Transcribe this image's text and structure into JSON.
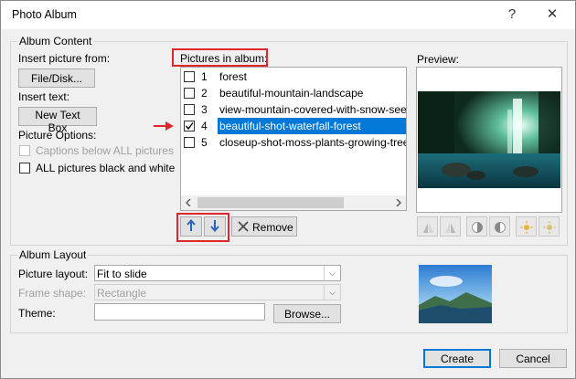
{
  "window": {
    "title": "Photo Album",
    "help": "?",
    "close": "✕"
  },
  "album_content": {
    "legend": "Album Content",
    "insert_picture_from": "Insert picture from:",
    "file_disk_button": "File/Disk...",
    "insert_text": "Insert text:",
    "new_text_box_button": "New Text Box",
    "picture_options": "Picture Options:",
    "captions_below": "Captions below ALL pictures",
    "all_black_white": "ALL pictures black and white",
    "pictures_in_album": "Pictures in album:",
    "items": [
      {
        "num": "1",
        "name": "forest",
        "checked": false,
        "selected": false
      },
      {
        "num": "2",
        "name": "beautiful-mountain-landscape",
        "checked": false,
        "selected": false
      },
      {
        "num": "3",
        "name": "view-mountain-covered-with-snow-seen",
        "checked": false,
        "selected": false
      },
      {
        "num": "4",
        "name": "beautiful-shot-waterfall-forest",
        "checked": true,
        "selected": true
      },
      {
        "num": "5",
        "name": "closeup-shot-moss-plants-growing-tree",
        "checked": false,
        "selected": false
      }
    ],
    "remove_button": "Remove",
    "preview_label": "Preview:"
  },
  "album_layout": {
    "legend": "Album Layout",
    "picture_layout_label": "Picture layout:",
    "picture_layout_value": "Fit to slide",
    "frame_shape_label": "Frame shape:",
    "frame_shape_value": "Rectangle",
    "theme_label": "Theme:",
    "theme_value": "",
    "browse_button": "Browse..."
  },
  "footer": {
    "create_button": "Create",
    "cancel_button": "Cancel"
  },
  "colors": {
    "selection": "#0078d7",
    "annotation": "#e0262b",
    "dialog_bg": "#f0f0f0"
  }
}
